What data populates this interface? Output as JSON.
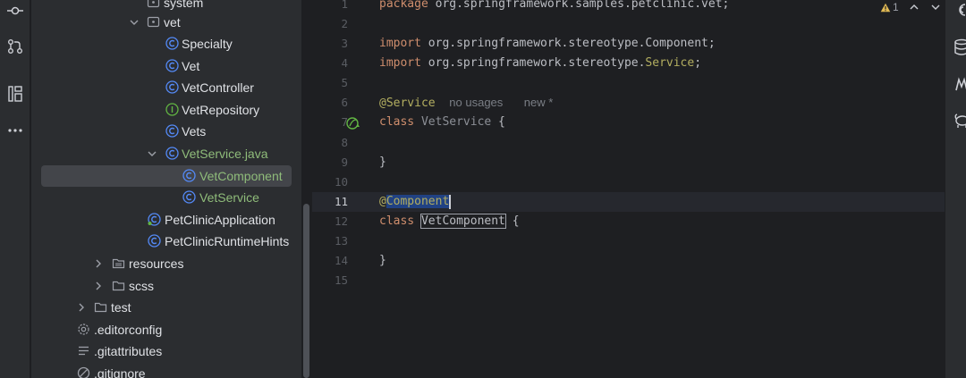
{
  "tree": {
    "items": [
      {
        "label": "system",
        "type": "package",
        "depth": 3
      },
      {
        "label": "vet",
        "type": "package",
        "depth": 3,
        "expanded": true
      },
      {
        "label": "Specialty",
        "type": "class"
      },
      {
        "label": "Vet",
        "type": "class"
      },
      {
        "label": "VetController",
        "type": "class"
      },
      {
        "label": "VetRepository",
        "type": "interface"
      },
      {
        "label": "Vets",
        "type": "class"
      },
      {
        "label": "VetService.java",
        "type": "class-file",
        "expanded": true
      },
      {
        "label": "VetComponent",
        "type": "class"
      },
      {
        "label": "VetService",
        "type": "class"
      },
      {
        "label": "PetClinicApplication",
        "type": "spring-class"
      },
      {
        "label": "PetClinicRuntimeHints",
        "type": "class"
      },
      {
        "label": "resources",
        "type": "folder"
      },
      {
        "label": "scss",
        "type": "folder"
      },
      {
        "label": "test",
        "type": "folder"
      },
      {
        "label": ".editorconfig",
        "type": "config"
      },
      {
        "label": ".gitattributes",
        "type": "text"
      },
      {
        "label": ".gitignore",
        "type": "ignore"
      }
    ]
  },
  "editor": {
    "line_numbers": [
      "1",
      "2",
      "3",
      "4",
      "5",
      "6",
      "7",
      "8",
      "9",
      "10",
      "11",
      "12",
      "13",
      "14",
      "15"
    ],
    "lines": {
      "l1_kw": "package",
      "l1_rest": " org.springframework.samples.petclinic.vet;",
      "l3_kw": "import",
      "l3_rest": " org.springframework.stereotype.",
      "l3_cls": "Component",
      "l3_end": ";",
      "l4_kw": "import",
      "l4_rest": " org.springframework.stereotype.",
      "l4_cls": "Service",
      "l4_end": ";",
      "l6_anno": "@Service",
      "l6_hint1": "no usages",
      "l6_hint2": "new *",
      "l7_kw": "class",
      "l7_name": " VetService",
      "l7_end": " {",
      "l9": "}",
      "l11_at": "@",
      "l11_anno": "Component",
      "l12_kw": "class",
      "l12_name": "VetComponent",
      "l12_end": " {",
      "l14": "}"
    },
    "warning_count": "1"
  },
  "colors": {
    "background": "#1e1f22",
    "panel": "#2b2d30",
    "keyword": "#cf8e6d",
    "annotation": "#b3ae60",
    "class_icon": "#548af7",
    "interface_icon": "#62b543",
    "modified_file": "#8fbc7a"
  },
  "icons": {
    "activity": [
      "commit-icon",
      "pull-requests-icon",
      "structure-icon",
      "more-icon"
    ],
    "right_strip": [
      "ai-assistant-icon",
      "database-icon",
      "maven-icon",
      "gradle-icon"
    ]
  }
}
